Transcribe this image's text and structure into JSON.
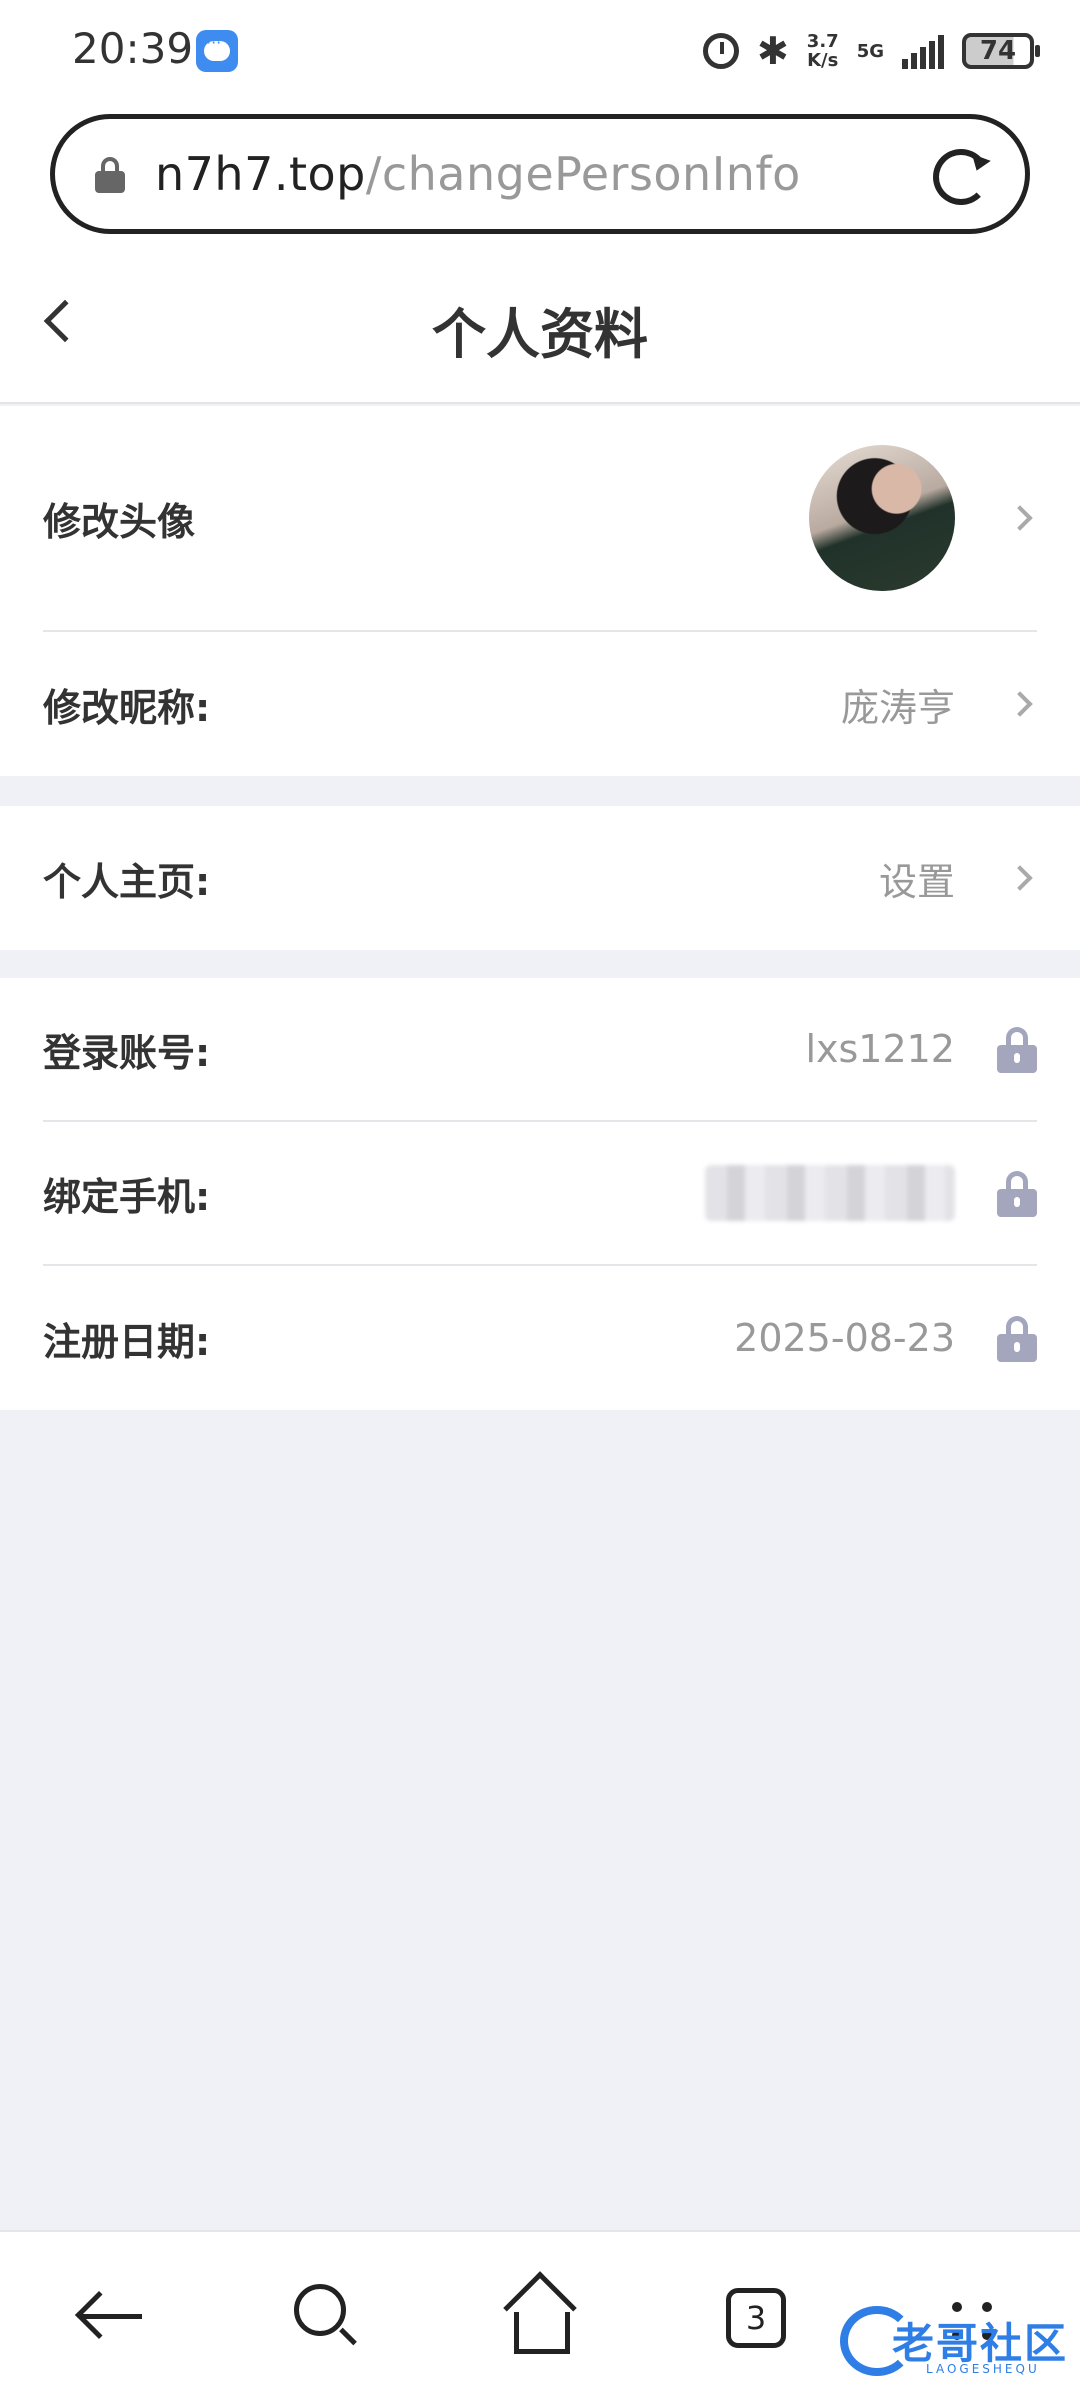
{
  "status_bar": {
    "time": "20:39",
    "speed_value": "3.7",
    "speed_unit": "K/s",
    "network": "5G",
    "battery": "74"
  },
  "browser": {
    "url_host": "n7h7.top",
    "url_path": "/changePersonInfo",
    "tab_count": "3"
  },
  "header": {
    "title": "个人资料"
  },
  "profile": {
    "avatar_label": "修改头像",
    "nickname_label": "修改昵称:",
    "nickname_value": "庞涛亨",
    "homepage_label": "个人主页:",
    "homepage_value": "设置",
    "account_label": "登录账号:",
    "account_value": "lxs1212",
    "phone_label": "绑定手机:",
    "register_label": "注册日期:",
    "register_value": "2025-08-23"
  },
  "watermark": {
    "text": "老哥社区",
    "sub": "LAOGESHEQU"
  },
  "colors": {
    "page_bg": "#f0f1f6",
    "lock_icon": "#a3a6bd",
    "value_text": "#999999",
    "watermark": "#2f7ee6"
  }
}
